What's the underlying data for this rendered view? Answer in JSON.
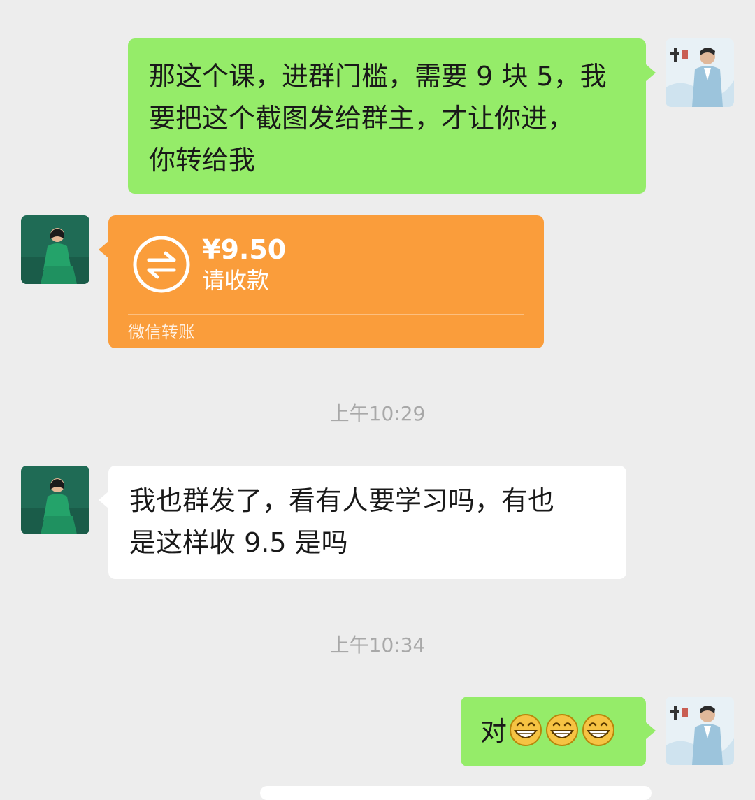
{
  "messages": [
    {
      "sender": "self",
      "lines": [
        "那这个课，进群门槛，需要 9 块 5，我",
        "要把这个截图发给群主，才让你进，",
        "你转给我"
      ]
    },
    {
      "sender": "other",
      "transfer": {
        "amount": "¥9.50",
        "status": "请收款",
        "label": "微信转账"
      }
    },
    {
      "timestamp": "上午10:29"
    },
    {
      "sender": "other",
      "lines": [
        "我也群发了，看有人要学习吗，有也",
        "是这样收 9.5 是吗"
      ]
    },
    {
      "timestamp": "上午10:34"
    },
    {
      "sender": "self",
      "text": "对",
      "emojis": [
        "grin-emoji",
        "grin-emoji",
        "grin-emoji"
      ]
    }
  ],
  "icons": {
    "transfer": "transfer-arrows-icon",
    "avatar_self": "avatar-man-blue-suit",
    "avatar_other": "avatar-woman-green-suit"
  },
  "colors": {
    "background": "#ededed",
    "self_bubble": "#95ec69",
    "other_bubble": "#ffffff",
    "transfer_card": "#fa9d3b",
    "timestamp": "#a8a8a8"
  }
}
